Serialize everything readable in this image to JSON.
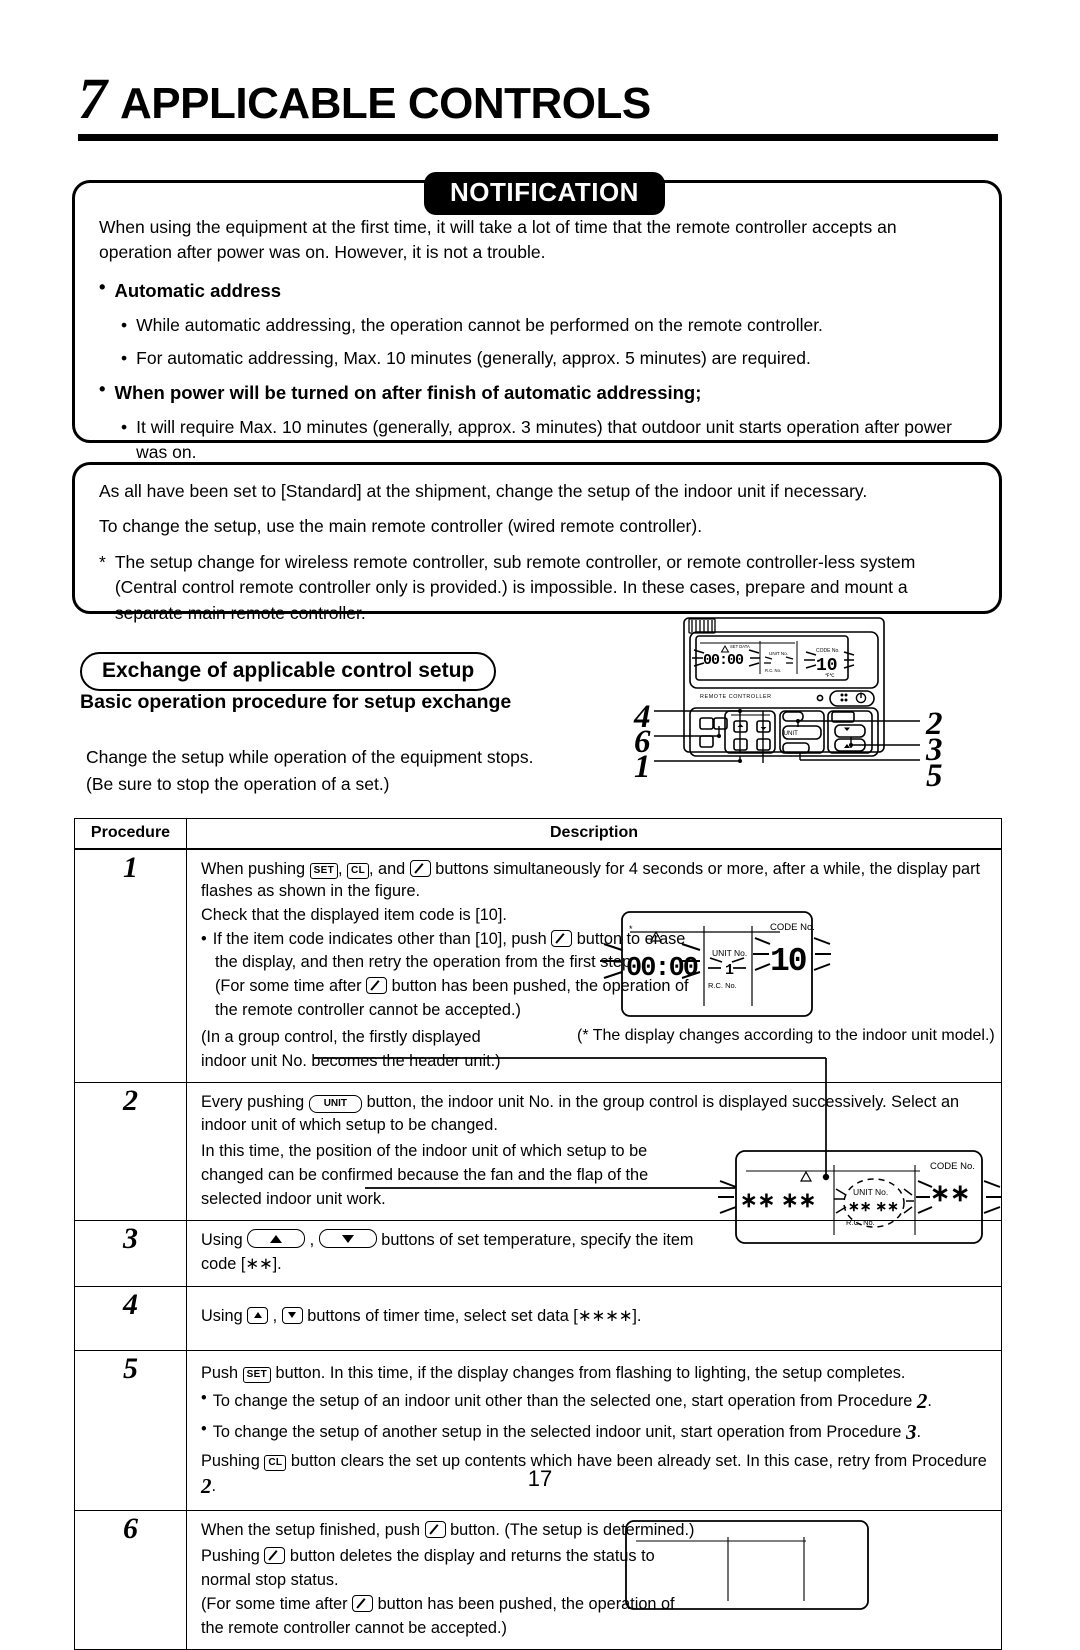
{
  "chapter": {
    "number": "7",
    "title": "APPLICABLE CONTROLS"
  },
  "notification": {
    "badge": "NOTIFICATION",
    "intro": "When using the equipment at the first time, it will take a lot of time that the remote controller accepts an operation after power was on. However, it is not a trouble.",
    "groups": [
      {
        "heading": "Automatic address",
        "bullet": "•",
        "items": [
          "While automatic addressing, the operation cannot be performed on the remote controller.",
          "For automatic addressing, Max. 10 minutes (generally, approx. 5 minutes) are required."
        ]
      },
      {
        "heading": "When power will be turned on after finish of automatic addressing;",
        "bullet": "•",
        "items": [
          "It will require Max. 10 minutes (generally, approx. 3 minutes) that outdoor unit starts operation after power was on."
        ]
      }
    ]
  },
  "setup_note": {
    "line1": "As all have been set to [Standard] at the shipment, change the setup of the indoor unit if necessary.",
    "line2": "To change the setup, use the main remote controller (wired remote controller).",
    "star": "*",
    "line3": "The setup change for wireless remote controller, sub remote controller, or remote controller-less system (Central control remote controller only is provided.) is impossible. In these cases, prepare and mount a separate main remote controller."
  },
  "section": {
    "pill_title": "Exchange of applicable control setup",
    "subtitle": "Basic operation procedure for setup exchange",
    "intro_line1": "Change the setup while operation of the equipment stops.",
    "intro_line2": "(Be sure to stop the operation of a set.)"
  },
  "remote_figure": {
    "label_remote_controller": "REMOTE CONTROLLER",
    "label_unit_button": "UNIT",
    "lcd": {
      "set_data": "SET DATA",
      "time": "00:00",
      "unit_no": "UNIT No.",
      "rc_no": "R.C.   No.",
      "code_no": "CODE No.",
      "code_value": "10",
      "temp_units": "℉℃"
    },
    "callouts_left": [
      "4",
      "6",
      "1"
    ],
    "callouts_right": [
      "2",
      "3",
      "5"
    ]
  },
  "table": {
    "headers": {
      "procedure": "Procedure",
      "description": "Description"
    },
    "rows": [
      {
        "num": "1",
        "lines": [
          {
            "type": "text-keys",
            "parts": [
              "When pushing ",
              "KEY:SET",
              ", ",
              "KEY:CL",
              ", and ",
              "KEY:CHECK",
              " buttons simultaneously for 4 seconds or more, after a while, the display part flashes as shown in the figure."
            ]
          },
          {
            "type": "text",
            "value": "Check that the displayed item code is [10]."
          },
          {
            "type": "bullet-keys",
            "parts": [
              "If the item code indicates other than [10], push ",
              "KEY:CHECK",
              " button to erase"
            ]
          },
          {
            "type": "indent",
            "value": "the display, and then retry the operation from the first step."
          },
          {
            "type": "indent-keys",
            "parts": [
              "(For some time after ",
              "KEY:CHECK",
              " button has been pushed, the operation of"
            ]
          },
          {
            "type": "indent",
            "value": "the remote controller cannot be accepted.)"
          },
          {
            "type": "text",
            "value": "(In a group control, the firstly displayed"
          },
          {
            "type": "text",
            "value": "indoor unit No. becomes the header unit.)"
          }
        ],
        "footnote": "(* The display changes according to the indoor unit model.)",
        "lcd": {
          "star": "*",
          "time": "00:00",
          "unit_no": "UNIT No.",
          "rc_no": "R.C.   No.",
          "unit_value": "1",
          "code_no": "CODE No.",
          "code_value": "10"
        }
      },
      {
        "num": "2",
        "lines": [
          {
            "type": "text-keys",
            "parts": [
              "Every pushing ",
              "KEY:UNIT",
              " button, the indoor unit No. in the group control is displayed successively. Select an indoor unit of which setup to be changed."
            ]
          },
          {
            "type": "text",
            "value": "In this time, the position of the indoor unit of which setup to be"
          },
          {
            "type": "text",
            "value": "changed can be confirmed because the fan and the flap of the"
          },
          {
            "type": "text",
            "value": "selected indoor unit work."
          }
        ]
      },
      {
        "num": "3",
        "lines": [
          {
            "type": "text-keys",
            "parts": [
              "Using ",
              "KEY:UP_LG",
              " , ",
              "KEY:DOWN_LG",
              " buttons of set temperature, specify the item"
            ]
          },
          {
            "type": "text",
            "value": "code [∗∗]."
          }
        ]
      },
      {
        "num": "4",
        "lines": [
          {
            "type": "text-keys",
            "parts": [
              "Using ",
              "KEY:UP_SM",
              " , ",
              "KEY:DOWN_SM",
              " buttons of timer time, select set data [∗∗∗∗]."
            ]
          }
        ]
      },
      {
        "num": "5",
        "lines": [
          {
            "type": "text-keys",
            "parts": [
              "Push ",
              "KEY:SET",
              " button. In this time, if the display changes from flashing to lighting, the setup completes."
            ]
          },
          {
            "type": "bullet-ref",
            "parts": [
              "To change the setup of an indoor unit other than the selected one, start operation from Procedure ",
              "REF:2",
              "."
            ]
          },
          {
            "type": "bullet-ref",
            "parts": [
              "To change the setup of another setup in the selected indoor unit, start operation from Procedure ",
              "REF:3",
              "."
            ]
          },
          {
            "type": "text-keys-ref",
            "parts": [
              "Pushing ",
              "KEY:CL",
              " button clears the set up contents which have been already set. In this case, retry from Procedure ",
              "REF:2",
              "."
            ]
          }
        ]
      },
      {
        "num": "6",
        "lines": [
          {
            "type": "text-keys",
            "parts": [
              "When the setup finished, push ",
              "KEY:CHECK",
              " button. (The setup is determined.)"
            ]
          },
          {
            "type": "text-keys",
            "parts": [
              "Pushing ",
              "KEY:CHECK",
              " button deletes the display and returns the status to"
            ]
          },
          {
            "type": "text",
            "value": "normal stop status."
          },
          {
            "type": "text-keys",
            "parts": [
              "(For some time after ",
              "KEY:CHECK",
              " button has been pushed, the operation of"
            ]
          },
          {
            "type": "text",
            "value": "the remote controller cannot be accepted.)"
          }
        ]
      }
    ],
    "lcd_34": {
      "left_value": "∗∗ ∗∗",
      "unit_no": "UNIT No.",
      "unit_value": "∗∗ ∗∗",
      "rc_no": "R.C.   No.",
      "code_no": "CODE No.",
      "code_value": "∗∗"
    }
  },
  "page_number": "17"
}
